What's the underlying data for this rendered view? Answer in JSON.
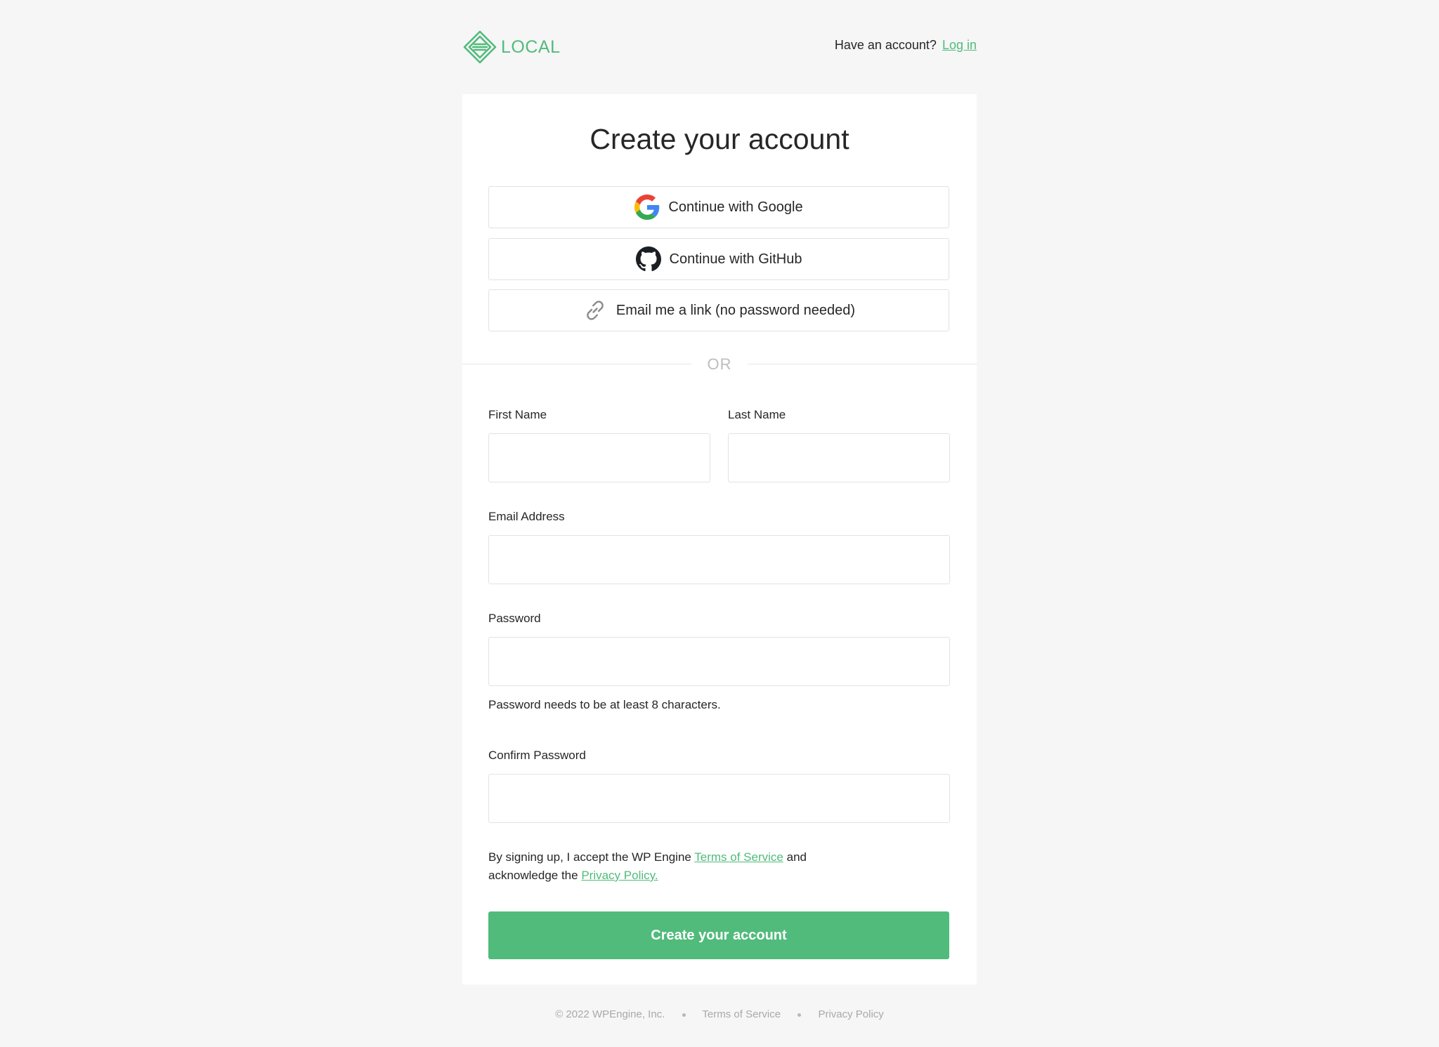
{
  "header": {
    "logo_text": "LOCAL",
    "have_account_text": "Have an account?",
    "login_link": "Log in"
  },
  "card": {
    "title": "Create your account",
    "sso": {
      "google_label": "Continue with Google",
      "github_label": "Continue with GitHub",
      "email_link_label": "Email me a link (no password needed)"
    },
    "divider_text": "OR",
    "form": {
      "first_name_label": "First Name",
      "first_name_value": "",
      "last_name_label": "Last Name",
      "last_name_value": "",
      "email_label": "Email Address",
      "email_value": "",
      "password_label": "Password",
      "password_value": "",
      "password_hint": "Password needs to be at least 8 characters.",
      "confirm_password_label": "Confirm Password",
      "confirm_password_value": ""
    },
    "terms": {
      "prefix": "By signing up, I accept the WP Engine",
      "tos_link": "Terms of Service",
      "middle": "and acknowledge the",
      "privacy_link": "Privacy Policy."
    },
    "submit_label": "Create your account"
  },
  "footer": {
    "copyright": "© 2022 WPEngine, Inc.",
    "tos_link": "Terms of Service",
    "privacy_link": "Privacy Policy"
  },
  "colors": {
    "accent": "#51bb7b",
    "page_background": "#f6f6f6",
    "card_background": "#ffffff"
  },
  "icons": [
    "local-logo-icon",
    "google-icon",
    "github-icon",
    "link-icon"
  ]
}
